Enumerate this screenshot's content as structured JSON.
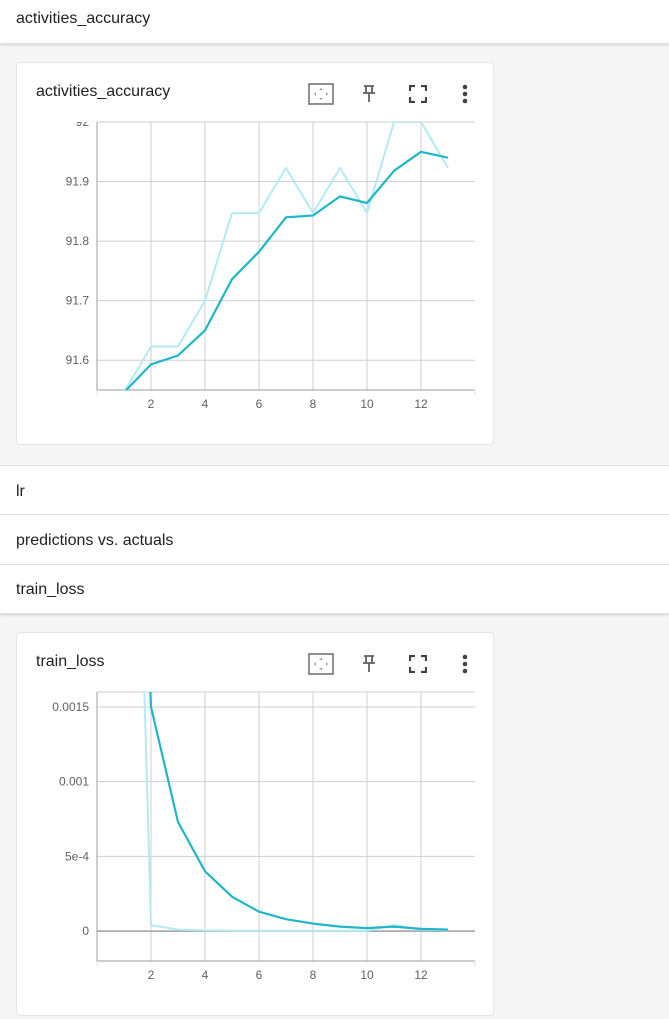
{
  "sections": {
    "activities_accuracy": "activities_accuracy",
    "lr": "lr",
    "predictions": "predictions vs. actuals",
    "train_loss": "train_loss"
  },
  "cards": {
    "accuracy_title": "activities_accuracy",
    "train_loss_title": "train_loss"
  },
  "icons": {
    "fit": "fit-domain-icon",
    "pin": "pin-icon",
    "fullscreen": "fullscreen-icon",
    "more": "more-vert-icon"
  },
  "colors": {
    "smoothed": "#1fb6c8",
    "raw": "#b2ebf2",
    "grid": "#cfcfcf",
    "axis": "#9e9e9e",
    "zero_line": "#9e9e9e"
  },
  "chart_data": [
    {
      "type": "line",
      "title": "activities_accuracy",
      "x_ticks": [
        2,
        4,
        6,
        8,
        10,
        12
      ],
      "y_ticks": [
        91.6,
        91.7,
        91.8,
        91.9
      ],
      "y_tick_labels": [
        "91.6",
        "91.7",
        "91.8",
        "91.9"
      ],
      "top_clip_label": "92",
      "xlim": [
        0,
        14
      ],
      "ylim": [
        91.55,
        92.0
      ],
      "series": [
        {
          "style": "raw",
          "x": [
            1,
            2,
            3,
            4,
            5,
            6,
            7,
            8,
            9,
            10,
            11,
            12,
            13
          ],
          "y": [
            91.546,
            91.623,
            91.623,
            91.7,
            91.847,
            91.847,
            91.923,
            91.847,
            91.923,
            91.847,
            92.0,
            92.0,
            91.923
          ]
        },
        {
          "style": "smoothed",
          "x": [
            1,
            2,
            3,
            4,
            5,
            6,
            7,
            8,
            9,
            10,
            11,
            12,
            13
          ],
          "y": [
            91.546,
            91.593,
            91.608,
            91.65,
            91.736,
            91.782,
            91.84,
            91.843,
            91.875,
            91.864,
            91.918,
            91.95,
            91.94
          ]
        }
      ]
    },
    {
      "type": "line",
      "title": "train_loss",
      "x_ticks": [
        2,
        4,
        6,
        8,
        10,
        12
      ],
      "y_ticks": [
        0,
        0.0005,
        0.001,
        0.0015
      ],
      "y_tick_labels": [
        "0",
        "5e-4",
        "0.001",
        "0.0015"
      ],
      "xlim": [
        0,
        14
      ],
      "ylim": [
        -0.0002,
        0.0016
      ],
      "series": [
        {
          "style": "raw",
          "x": [
            1,
            2,
            3,
            4,
            5,
            6,
            7,
            8,
            9,
            10,
            11,
            12,
            13
          ],
          "y": [
            0.0064,
            4e-05,
            1e-05,
            5e-06,
            3e-06,
            2e-06,
            2e-06,
            2e-06,
            2e-06,
            2e-06,
            4e-05,
            1e-05,
            5e-06
          ]
        },
        {
          "style": "smoothed",
          "x": [
            1,
            2,
            3,
            4,
            5,
            6,
            7,
            8,
            9,
            10,
            11,
            12,
            13
          ],
          "y": [
            0.0064,
            0.0015,
            0.00073,
            0.0004,
            0.00023,
            0.00013,
            8e-05,
            5e-05,
            3e-05,
            2e-05,
            3e-05,
            1.5e-05,
            1e-05
          ]
        }
      ]
    }
  ]
}
